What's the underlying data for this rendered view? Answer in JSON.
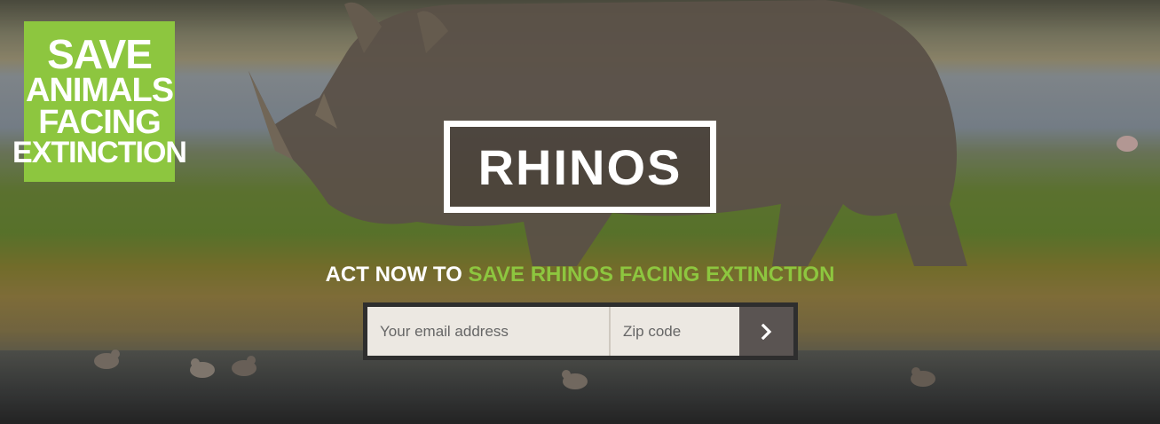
{
  "logo": {
    "line1": "SAVE",
    "line2": "ANIMALS",
    "line3": "FACING",
    "line4": "EXTINCTION"
  },
  "hero": {
    "title": "RHINOS"
  },
  "cta": {
    "prefix": "ACT NOW TO",
    "highlight": "SAVE RHINOS FACING EXTINCTION"
  },
  "form": {
    "email_placeholder": "Your email address",
    "zip_placeholder": "Zip code",
    "submit_icon": "chevron-right-icon"
  },
  "colors": {
    "brand_green": "#8dc63f",
    "form_frame": "#2e2e2e",
    "submit_bg": "#5a5452"
  }
}
